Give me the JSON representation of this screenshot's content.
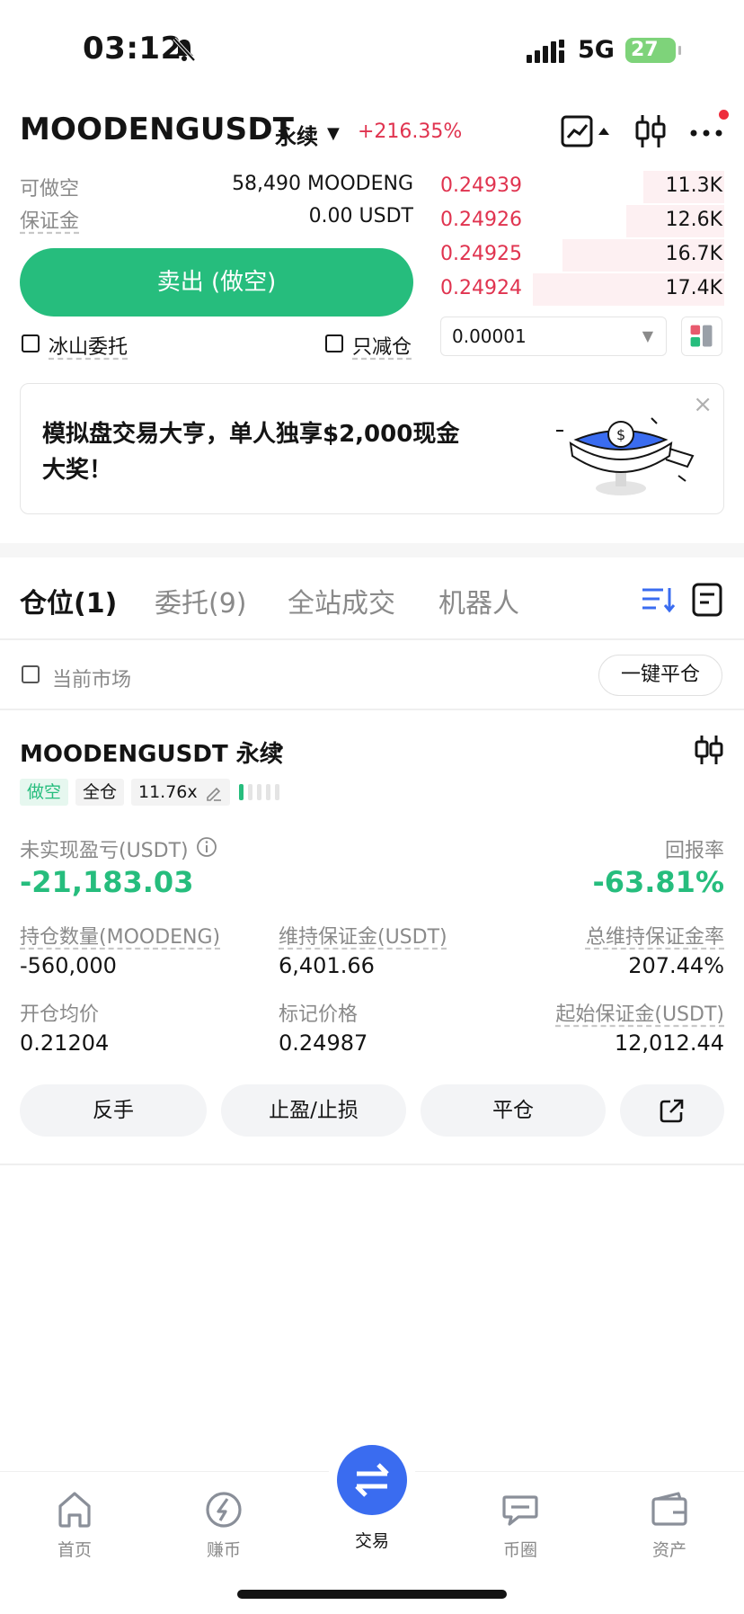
{
  "status_bar": {
    "time": "03:12",
    "network": "5G",
    "battery": "27"
  },
  "header": {
    "symbol": "MOODENGUSDT",
    "contract_type": "永续",
    "change": "+216.35%",
    "icons": [
      "chart-line-icon",
      "candlestick-icon",
      "more-icon"
    ]
  },
  "trade_panel": {
    "short_available_label": "可做空",
    "short_available_value": "58,490 MOODENG",
    "margin_label": "保证金",
    "margin_value": "0.00 USDT",
    "sell_button": "卖出 (做空)",
    "iceberg_label": "冰山委托",
    "reduce_only_label": "只减仓"
  },
  "orderbook": {
    "asks": [
      {
        "price": "0.24939",
        "size": "11.3K",
        "depth": 0.28
      },
      {
        "price": "0.24926",
        "size": "12.6K",
        "depth": 0.34
      },
      {
        "price": "0.24925",
        "size": "16.7K",
        "depth": 0.56
      },
      {
        "price": "0.24924",
        "size": "17.4K",
        "depth": 0.66
      }
    ],
    "step": "0.00001"
  },
  "banner": {
    "text": "模拟盘交易大亨，单人独享$2,000现金大奖！",
    "close": "×"
  },
  "tabs": [
    {
      "label": "仓位(1)",
      "active": true
    },
    {
      "label": "委托(9)",
      "active": false
    },
    {
      "label": "全站成交",
      "active": false
    },
    {
      "label": "机器人",
      "active": false
    }
  ],
  "filter": {
    "current_market_label": "当前市场",
    "close_all_button": "一键平仓"
  },
  "position": {
    "symbol": "MOODENGUSDT 永续",
    "side": "做空",
    "margin_mode": "全仓",
    "leverage": "11.76x",
    "unrealized_pnl_label": "未实现盈亏(USDT)",
    "unrealized_pnl": "-21,183.03",
    "roe_label": "回报率",
    "roe": "-63.81%",
    "size_label": "持仓数量(MOODENG)",
    "size": "-560,000",
    "maint_margin_label": "维持保证金(USDT)",
    "maint_margin": "6,401.66",
    "maint_ratio_label": "总维持保证金率",
    "maint_ratio": "207.44%",
    "entry_label": "开仓均价",
    "entry": "0.21204",
    "mark_label": "标记价格",
    "mark": "0.24987",
    "init_margin_label": "起始保证金(USDT)",
    "init_margin": "12,012.44",
    "actions": [
      "反手",
      "止盈/止损",
      "平仓"
    ]
  },
  "bottom_nav": [
    {
      "label": "首页",
      "icon": "home-icon"
    },
    {
      "label": "赚币",
      "icon": "earn-icon"
    },
    {
      "label": "交易",
      "icon": "trade-swap-icon"
    },
    {
      "label": "币圈",
      "icon": "community-icon"
    },
    {
      "label": "资产",
      "icon": "wallet-icon"
    }
  ],
  "colors": {
    "green": "#26bd7d",
    "red": "#e0334f",
    "blue": "#3a6cf0"
  }
}
